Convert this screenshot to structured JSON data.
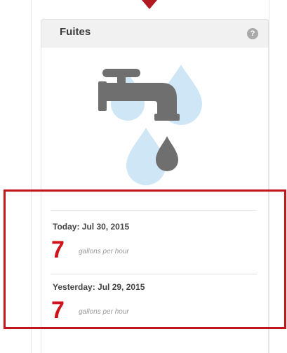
{
  "widget": {
    "title": "Fuites",
    "help_icon": "question-circle-icon",
    "illustration": "faucet-leak-icon"
  },
  "readings": [
    {
      "label": "Today: Jul 30, 2015",
      "value": "7",
      "unit": "gallons per hour"
    },
    {
      "label": "Yesterday: Jul 29, 2015",
      "value": "7",
      "unit": "gallons per hour"
    }
  ],
  "colors": {
    "accent_red": "#d0121b",
    "highlight_border": "#c3141c",
    "faucet_gray": "#6f6f6f",
    "water_blue": "#cfe6f7"
  }
}
